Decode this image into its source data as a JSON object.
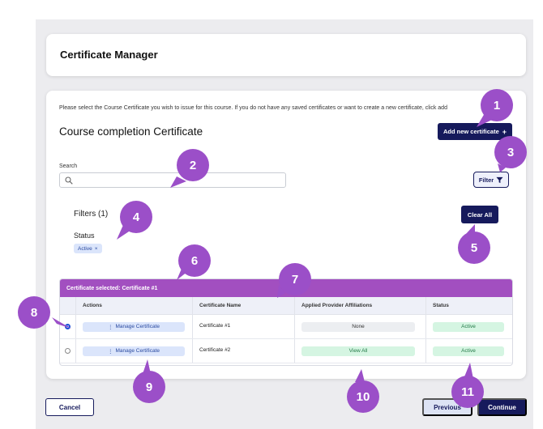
{
  "header": {
    "title": "Certificate Manager"
  },
  "intro_text": "Please select the Course Certificate you wish to issue for this course. If you do not have any saved certificates or want to create a new certificate, click add",
  "section_title": "Course completion Certificate",
  "add_button": {
    "label": "Add new certificate",
    "icon": "+"
  },
  "search": {
    "label": "Search",
    "placeholder": "",
    "value": ""
  },
  "filter_button": {
    "label": "Filter",
    "icon": "filter-funnel-icon"
  },
  "filters": {
    "title": "Filters (1)",
    "status_label": "Status",
    "chip": {
      "label": "Active",
      "remove_icon": "×"
    },
    "clear_label": "Clear All"
  },
  "table": {
    "selected_banner": "Certificate selected: Certificate #1",
    "headers": [
      "Actions",
      "Certificate Name",
      "Applied Provider Affiliations",
      "Status"
    ],
    "rows": [
      {
        "selected": true,
        "action": "Manage Certificate",
        "name": "Certificate #1",
        "affiliations": "None",
        "status": "Active"
      },
      {
        "selected": false,
        "action": "Manage Certificate",
        "name": "Certificate #2",
        "affiliations": "View All",
        "status": "Active"
      }
    ]
  },
  "footer": {
    "cancel": "Cancel",
    "previous": "Previous",
    "continue": "Continue"
  },
  "callouts": [
    "1",
    "2",
    "3",
    "4",
    "5",
    "6",
    "7",
    "8",
    "9",
    "10",
    "11"
  ],
  "colors": {
    "primary": "#161a5c",
    "accent": "#a24fc0",
    "badge": "#9b4fc8",
    "chip": "#dbe5fb",
    "success": "#d5f5e2"
  }
}
